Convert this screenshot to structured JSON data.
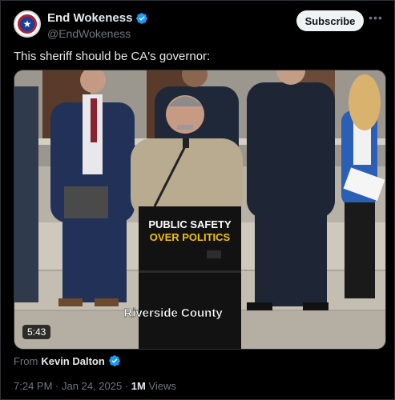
{
  "post": {
    "display_name": "End Wokeness",
    "handle": "@EndWokeness",
    "subscribe_label": "Subscribe",
    "more_label": "•••",
    "text": "This sheriff should be CA's governor:",
    "video": {
      "duration": "5:43",
      "podium_line1": "PUBLIC SAFETY",
      "podium_line2": "OVER POLITICS",
      "caption": "Riverside County"
    },
    "from_label": "From",
    "from_name": "Kevin Dalton",
    "time": "7:24 PM",
    "separator": "·",
    "date": "Jan 24, 2025",
    "views_count": "1M",
    "views_label": "Views"
  },
  "colors": {
    "verified_blue": "#1d9bf0",
    "background": "#000000",
    "text_primary": "#e7e9ea",
    "text_secondary": "#71767b",
    "podium_yellow": "#f2c200"
  },
  "icons": {
    "verified": "verified-badge-icon",
    "more": "more-options-icon",
    "avatar": "account-logo"
  }
}
